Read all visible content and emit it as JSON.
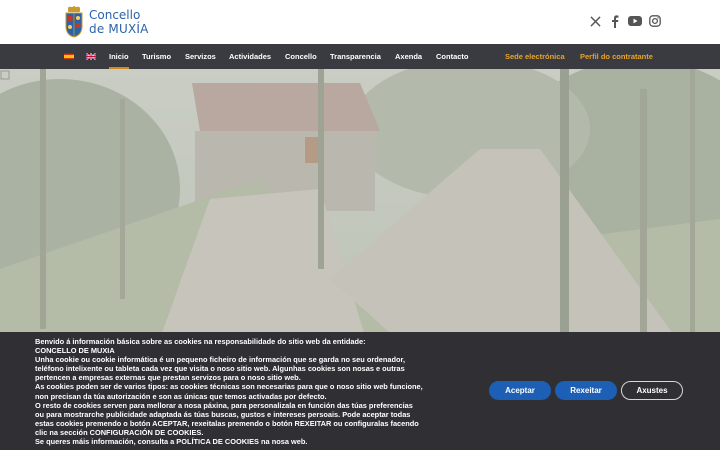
{
  "header": {
    "logo_line1": "Concello",
    "logo_line2": "de MUXÍA",
    "social_icons": [
      "x-icon",
      "facebook-icon",
      "youtube-icon",
      "instagram-icon"
    ]
  },
  "nav": {
    "flags": [
      "spanish-flag",
      "uk-flag"
    ],
    "items": [
      {
        "label": "Inicio",
        "active": true
      },
      {
        "label": "Turismo"
      },
      {
        "label": "Servizos"
      },
      {
        "label": "Actividades"
      },
      {
        "label": "Concello"
      },
      {
        "label": "Transparencia"
      },
      {
        "label": "Axenda"
      },
      {
        "label": "Contacto"
      }
    ],
    "right_links": [
      "Sede electrónica",
      "Perfil do contratante"
    ],
    "accent_color": "#e9a32b",
    "bar_color": "#393b40"
  },
  "cookie": {
    "lines": [
      "Benvido á información básica sobre as cookies na responsabilidade do sitio web da entidade:",
      "CONCELLO DE MUXIA",
      "Unha cookie ou cookie informática é un pequeno ficheiro de información que se garda no seu ordenador,",
      "teléfono intelixente ou tableta cada vez que visita o noso sitio web. Algunhas cookies son nosas e outras",
      "pertencen a empresas externas que prestan servizos para o noso sitio web.",
      "As cookies poden ser de varios tipos: as cookies técnicas son necesarias para que o noso sitio web funcione,",
      "non precisan da túa autorización e son as únicas que temos activadas por defecto.",
      "O resto de cookies serven para mellorar a nosa páxina, para personalizala en función das túas preferencias",
      "ou para mostrarche publicidade adaptada ás túas buscas, gustos e intereses persoais. Pode aceptar todas",
      "estas cookies premendo o botón ACEPTAR, rexeitalas premendo o botón REXEITAR ou configuralas facendo",
      "clic na sección CONFIGURACIÓN DE COOKIES.",
      "Se queres máis información, consulta a POLÍTICA DE COOKIES na nosa web."
    ],
    "accept_label": "Aceptar",
    "reject_label": "Rexeitar",
    "settings_label": "Axustes",
    "button_color": "#1d5fb5"
  }
}
